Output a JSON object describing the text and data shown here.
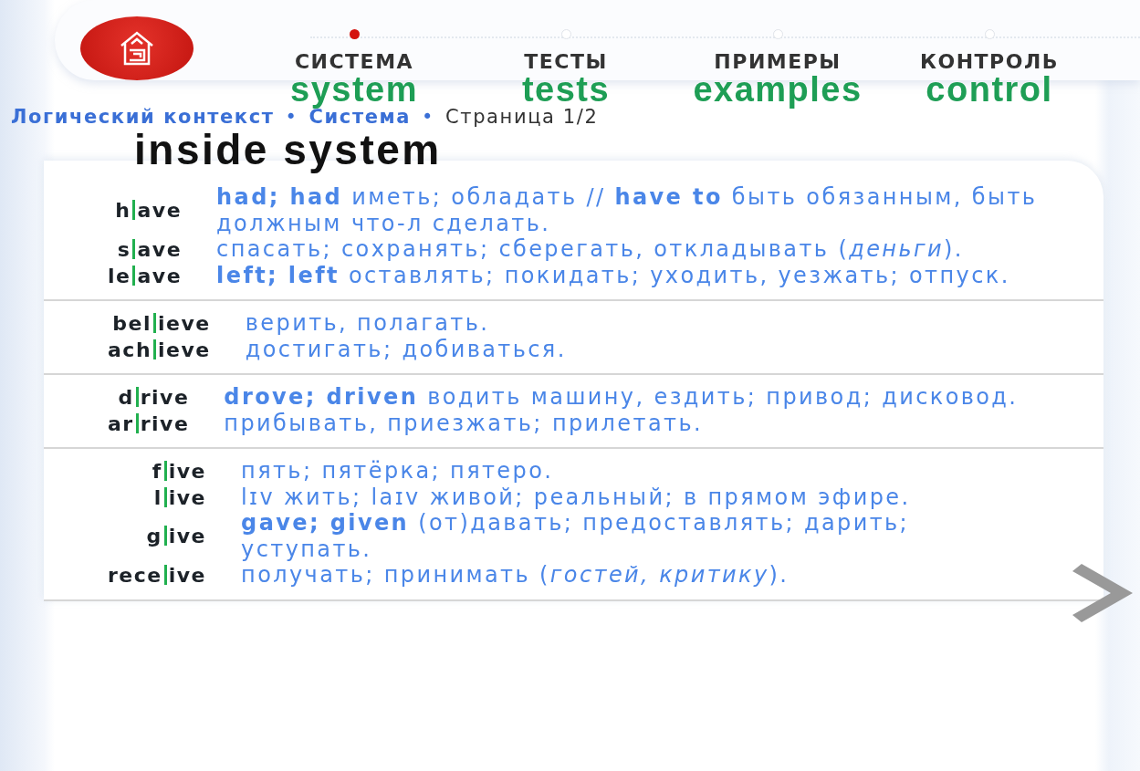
{
  "tabs": [
    {
      "label": "СИСТЕМА",
      "gloss": "system",
      "selected": true
    },
    {
      "label": "ТЕСТЫ",
      "gloss": "tests",
      "selected": false
    },
    {
      "label": "ПРИМЕРЫ",
      "gloss": "examples",
      "selected": false
    },
    {
      "label": "КОНТРОЛЬ",
      "gloss": "control",
      "selected": false
    }
  ],
  "breadcrumb": {
    "links": [
      "Логический контекст",
      "Система"
    ],
    "separator": "•",
    "page": "Страница 1/2"
  },
  "heading": "inside system",
  "groups": [
    {
      "entries": [
        {
          "prefix": "h",
          "suffix": "ave",
          "definition": "**had; had** иметь; обладать // **have to** быть обязанным, быть должным что-л сделать."
        },
        {
          "prefix": "s",
          "suffix": "ave",
          "definition": "спасать; сохранять; сберегать, откладывать (*деньги*)."
        },
        {
          "prefix": "le",
          "suffix": "ave",
          "definition": "**left; left** оставлять; покидать; уходить, уезжать; отпуск."
        }
      ]
    },
    {
      "entries": [
        {
          "prefix": "bel",
          "suffix": "ieve",
          "definition": "верить, полагать."
        },
        {
          "prefix": "ach",
          "suffix": "ieve",
          "definition": "достигать; добиваться."
        }
      ]
    },
    {
      "entries": [
        {
          "prefix": "d",
          "suffix": "rive",
          "definition": "**drove; driven** водить машину, ездить; привод; дисковод."
        },
        {
          "prefix": "ar",
          "suffix": "rive",
          "definition": "прибывать, приезжать; прилетать."
        }
      ]
    },
    {
      "entries": [
        {
          "prefix": "f",
          "suffix": "ive",
          "definition": "пять; пятёрка; пятеро."
        },
        {
          "prefix": "l",
          "suffix": "ive",
          "definition": "lɪv жить; laɪv живой; реальный; в прямом эфире."
        },
        {
          "prefix": "g",
          "suffix": "ive",
          "definition": "**gave; given** (от)давать; предоставлять; дарить; уступать."
        },
        {
          "prefix": "rece",
          "suffix": "ive",
          "definition": "получать; принимать (*гостей, критику*)."
        }
      ]
    }
  ]
}
